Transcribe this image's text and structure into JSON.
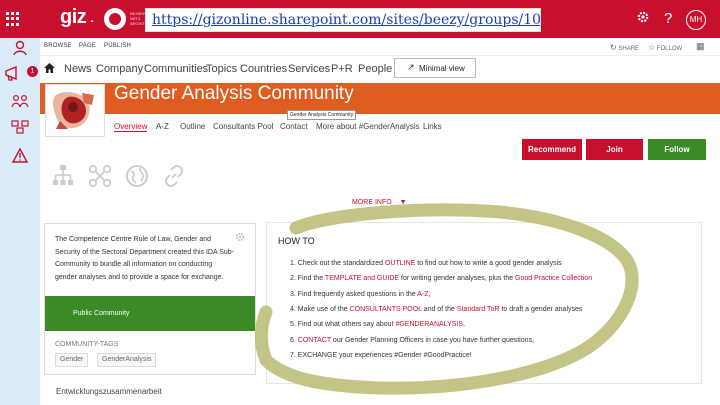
{
  "suitebar": {
    "brand": "giz",
    "brand_dot": ".",
    "brand_small": "BEZIEHUNGS NETZ ARCHITECTURE",
    "url": "https://gizonline.sharepoint.com/sites/beezy/groups/1015/SitePages/Init.aspx",
    "settings_icon": "gear-icon",
    "help_label": "?",
    "avatar_initials": "MH"
  },
  "rail": {
    "notification_count": "1"
  },
  "ribbon": {
    "browse": "BROWSE",
    "page": "PAGE",
    "publish": "PUBLISH",
    "share": "SHARE",
    "follow": "FOLLOW"
  },
  "topnav": {
    "items": [
      "News",
      "Company",
      "Communities",
      "Topics",
      "Countries",
      "Services",
      "P+R",
      "People"
    ],
    "minimal_view": "Minimal view"
  },
  "community": {
    "title": "Gender Analysis Community",
    "tooltip": "Gender Analysis Community",
    "subnav": [
      "Overview",
      "A-Z",
      "Outline",
      "Consultants Pool",
      "Contact",
      "More about #GenderAnalysis",
      "Links"
    ],
    "active_subnav": "Overview"
  },
  "actions": {
    "recommend": "Recommend",
    "join": "Join",
    "follow": "Follow"
  },
  "more_info": "MORE INFO",
  "info_card": {
    "description": "The Competence Centre Rule of Law, Gender and Security of the Sectoral Department created this IDA Sub-Community to bundle all information on conducting gender analyses and to provide a space for exchange.",
    "visibility": "Public Community",
    "tags_title": "COMMUNITY-TAGS",
    "tags": [
      "Gender",
      "GenderAnalysis"
    ]
  },
  "footer_text": "Entwicklungszusammenarbeit",
  "howto": {
    "title": "HOW TO",
    "steps": [
      {
        "n": "1.",
        "a": "Check out the standardized ",
        "l1": "OUTLINE",
        "b": " to find out how to write a good gender analysis",
        "l2": "",
        "c": ""
      },
      {
        "n": "2.",
        "a": "Find the ",
        "l1": "TEMPLATE and GUIDE",
        "b": " for writing gender analyses, plus the ",
        "l2": "Good Practice Collection",
        "c": ""
      },
      {
        "n": "3.",
        "a": "Find frequently asked questions in the ",
        "l1": "A-Z",
        "b": ",",
        "l2": "",
        "c": ""
      },
      {
        "n": "4.",
        "a": "Make use of the ",
        "l1": "CONSULTANTS POOL",
        "b": " and of the ",
        "l2": "Standard ToR",
        "c": " to draft a gender analyses"
      },
      {
        "n": "5.",
        "a": "Find out what others say about ",
        "l1": "#GENDERANALYSIS",
        "b": ",",
        "l2": "",
        "c": ""
      },
      {
        "n": "6.",
        "a": "",
        "l1": "CONTACT",
        "b": " our Gender Planning Officers in case you have further questions,",
        "l2": "",
        "c": ""
      },
      {
        "n": "7.",
        "a": "EXCHANGE your experiences #Gender #GoodPractice!",
        "l1": "",
        "b": "",
        "l2": "",
        "c": ""
      }
    ]
  },
  "colors": {
    "suitebar": "#c8102e",
    "banner": "#e05d22",
    "recommend": "#c8102e",
    "join": "#c8102e",
    "follow": "#3a8a26",
    "public": "#3a8a26",
    "scribble": "#bcbf7a"
  }
}
